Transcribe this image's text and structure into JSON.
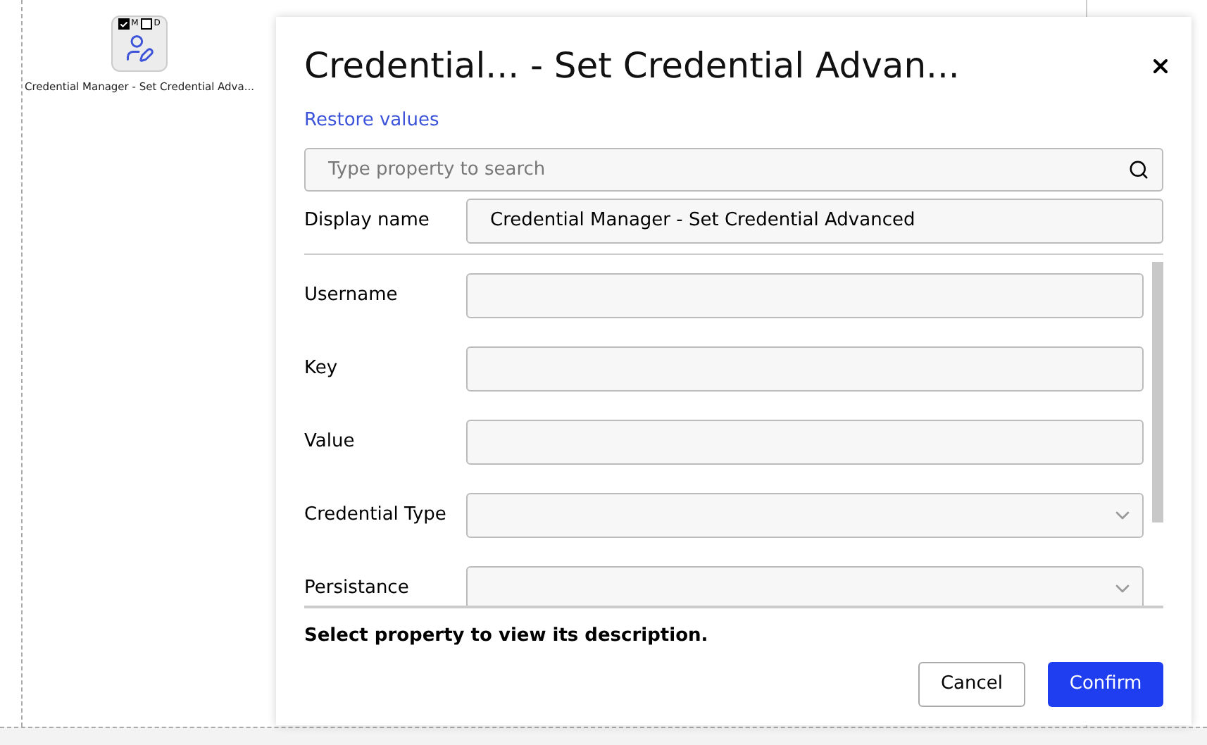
{
  "node": {
    "flags": [
      {
        "label": "M",
        "checked": true
      },
      {
        "label": "D",
        "checked": false
      }
    ],
    "label": "Credential Manager - Set Credential Adva..."
  },
  "dialog": {
    "title": "Credential... - Set Credential Advan...",
    "restore_link": "Restore values",
    "search": {
      "placeholder": "Type property to search"
    },
    "display_name": {
      "label": "Display name",
      "value": "Credential Manager - Set Credential Advanced"
    },
    "properties": [
      {
        "label": "Username",
        "kind": "text"
      },
      {
        "label": "Key",
        "kind": "text"
      },
      {
        "label": "Value",
        "kind": "text"
      },
      {
        "label": "Credential Type",
        "kind": "select"
      },
      {
        "label": "Persistance",
        "kind": "select"
      }
    ],
    "description": "Select property to view its description.",
    "buttons": {
      "cancel": "Cancel",
      "confirm": "Confirm"
    }
  }
}
